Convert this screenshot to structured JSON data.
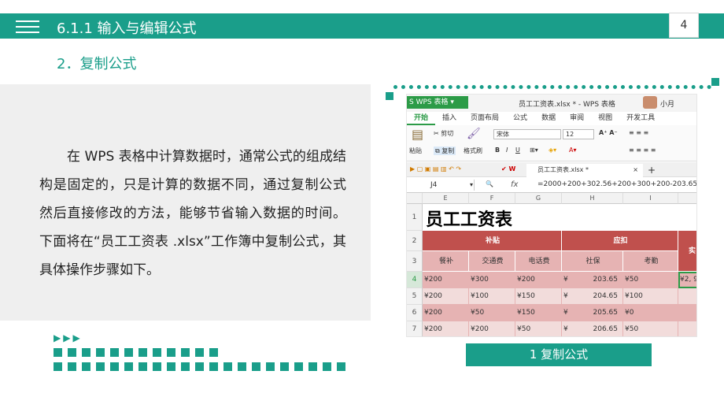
{
  "header": {
    "title": "6.1.1 输入与编辑公式",
    "page_number": "4"
  },
  "section_title": "2．复制公式",
  "body_text": "在 WPS 表格中计算数据时，通常公式的组成结构是固定的，只是计算的数据不同，通过复制公式然后直接修改的方法，能够节省输入数据的时间。下面将在“员工工资表 .xlsx”工作簿中复制公式，其具体操作步骤如下。",
  "decor_arrows": "▶▶▶",
  "caption": "1 复制公式",
  "screenshot": {
    "app_label": "WPS 表格",
    "window_title": "员工工资表.xlsx * - WPS 表格",
    "user": "小月",
    "tabs": [
      "开始",
      "插入",
      "页面布局",
      "公式",
      "数据",
      "审阅",
      "视图",
      "开发工具"
    ],
    "ribbon": {
      "paste": "粘贴",
      "cut": "剪切",
      "copy": "复制",
      "format_painter": "格式刷",
      "font": "宋体",
      "font_size": "12",
      "bold": "B",
      "italic": "I",
      "underline": "U"
    },
    "doc_tab": "员工工资表.xlsx *",
    "name_box": "J4",
    "fx": "fx",
    "formula": "=2000+200+302.56+200+300+200-203.65-",
    "columns": [
      "E",
      "F",
      "G",
      "H",
      "I"
    ],
    "rows": [
      "1",
      "2",
      "3",
      "4",
      "5",
      "6",
      "7"
    ],
    "sheet_title": "员工工资表",
    "group_headers": {
      "allowance": "补贴",
      "payable": "应扣",
      "actual": "实"
    },
    "sub_headers": [
      "餐补",
      "交通费",
      "电话费",
      "社保",
      "考勤"
    ],
    "data": [
      [
        "¥200",
        "¥300",
        "¥200",
        "¥",
        "203.65",
        "¥50",
        "¥2, 9"
      ],
      [
        "¥200",
        "¥100",
        "¥150",
        "¥",
        "204.65",
        "¥100",
        ""
      ],
      [
        "¥200",
        "¥50",
        "¥150",
        "¥",
        "205.65",
        "¥0",
        ""
      ],
      [
        "¥200",
        "¥200",
        "¥50",
        "¥",
        "206.65",
        "¥50",
        ""
      ]
    ]
  },
  "colors": {
    "accent": "#1a9e8a",
    "header_red": "#c0504d",
    "cell_pink": "#e6b3b3",
    "wps_green": "#2c9b47"
  }
}
